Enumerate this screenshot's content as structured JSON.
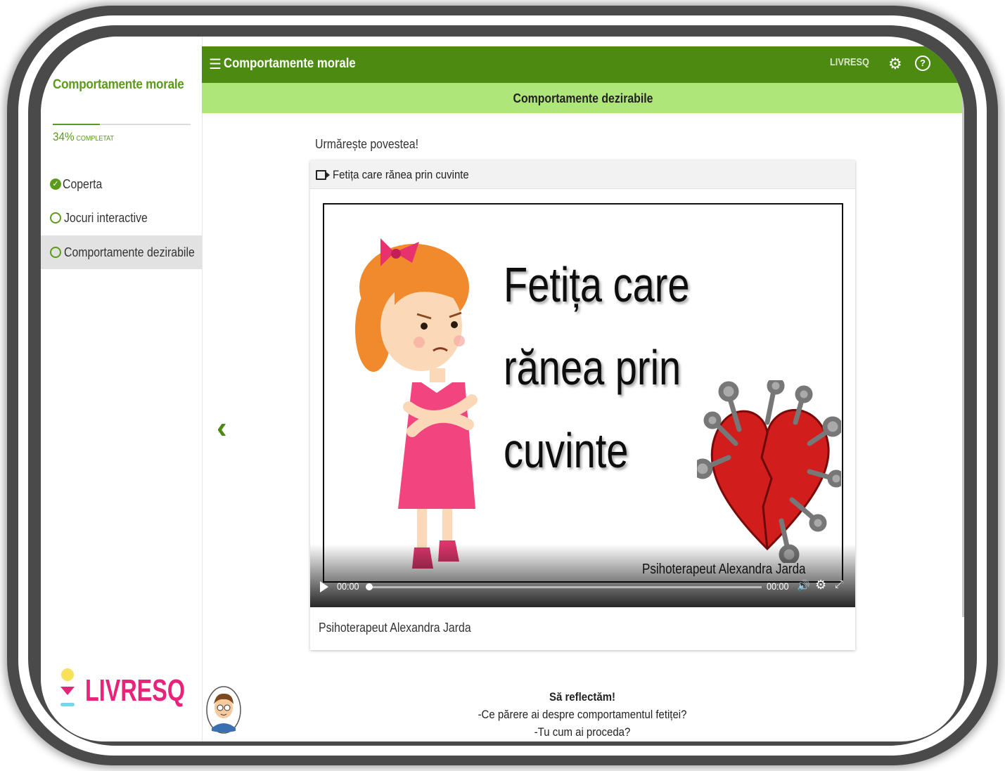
{
  "sidebar": {
    "title": "Comportamente morale",
    "progress_percent": 34,
    "progress_label": "34%",
    "progress_suffix": "COMPLETAT",
    "items": [
      {
        "label": "Coperta",
        "status": "completed"
      },
      {
        "label": "Jocuri interactive",
        "status": "incomplete"
      },
      {
        "label": "Comportamente dezirabile",
        "status": "incomplete",
        "active": true
      }
    ],
    "brand": "LIVRESQ"
  },
  "topbar": {
    "title": "Comportamente morale",
    "brand": "LIVRESQ",
    "icons": [
      "menu-icon",
      "gear-icon",
      "help-icon",
      "fullscreen-icon"
    ]
  },
  "subbar": {
    "title": "Comportamente dezirabile"
  },
  "main": {
    "instruction": "Urmărește  povestea!",
    "video_card": {
      "title": "Fetița care rănea prin cuvinte",
      "slide_title_lines": [
        "Fetița care",
        "rănea prin",
        "cuvinte"
      ],
      "slide_credit": "Psihoterapeut Alexandra Jarda",
      "time_current": "00:00",
      "time_total": "00:00",
      "progress": 0,
      "caption": "Psihoterapeut Alexandra Jarda"
    },
    "reflect": {
      "title": "Să reflectăm!",
      "lines": [
        "-Ce părere ai despre comportamentul fetiței?",
        "-Tu cum ai proceda?"
      ]
    }
  },
  "colors": {
    "primary_green": "#4d8a12",
    "light_green": "#aee67a",
    "brand_pink": "#e8237a"
  }
}
